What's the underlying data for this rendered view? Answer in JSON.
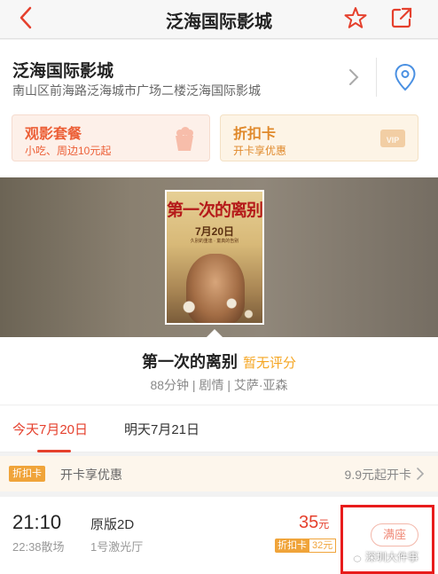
{
  "topbar": {
    "title": "泛海国际影城",
    "back_icon": "back-chevron-icon",
    "favorite_icon": "star-icon",
    "share_icon": "share-icon"
  },
  "cinema": {
    "name": "泛海国际影城",
    "address": "南山区前海路泛海城市广场二楼泛海国际影城"
  },
  "promos": [
    {
      "title": "观影套餐",
      "subtitle": "小吃、周边10元起",
      "icon": "snack-cup-icon"
    },
    {
      "title": "折扣卡",
      "subtitle": "开卡享优惠",
      "icon": "vip-card-icon"
    }
  ],
  "poster": {
    "title": "第一次的离别",
    "date": "7月20日",
    "tagline": "久别的重逢 · 童真的告别"
  },
  "movie": {
    "title": "第一次的离别",
    "rating": "暂无评分",
    "info": "88分钟 | 剧情 | 艾萨·亚森"
  },
  "dates": [
    {
      "label": "今天7月20日",
      "active": true
    },
    {
      "label": "明天7月21日",
      "active": false
    }
  ],
  "card_bar": {
    "tag": "折扣卡",
    "text": "开卡享优惠",
    "right_text": "9.9元起开卡"
  },
  "showtime": {
    "start": "21:10",
    "end": "22:38散场",
    "version": "原版2D",
    "hall": "1号激光厅",
    "price": "35",
    "price_unit": "元",
    "card_tag": "折扣卡",
    "card_price": "32元",
    "status": "满座"
  },
  "watermark": "深圳大件事",
  "colors": {
    "accent": "#e5402d",
    "orange": "#f0a43a",
    "rating": "#f5a623",
    "highlight_box": "#e81c1c"
  }
}
